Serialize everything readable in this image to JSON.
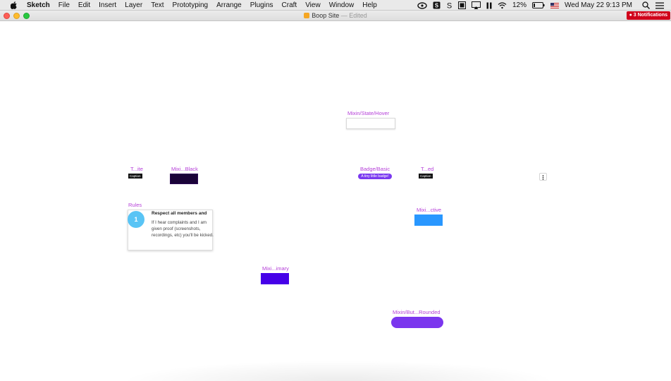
{
  "menubar": {
    "app_name": "Sketch",
    "items": [
      "File",
      "Edit",
      "Insert",
      "Layer",
      "Text",
      "Prototyping",
      "Arrange",
      "Plugins",
      "Craft",
      "View",
      "Window",
      "Help"
    ],
    "battery": "12%",
    "datetime": "Wed May 22  9:13 PM",
    "icons": [
      "creative-cloud-icon",
      "s-box-icon",
      "s-icon",
      "grid-icon",
      "airplay-icon",
      "pause-icon",
      "wifi-icon",
      "battery-icon",
      "flag-us-icon",
      "search-icon",
      "list-icon"
    ]
  },
  "window": {
    "title": "Boop Site",
    "edited_suffix": "— Edited",
    "notifications": "3 Notifications"
  },
  "canvas": {
    "hover_label": "Mixin/State/Hover",
    "white_label": "T...ite",
    "white_caption": "Caption",
    "black_label": "Mixi...Black",
    "badge_label": "Badge/Basic",
    "badge_text": "A tiny little badge!",
    "ted_label": "T...ed",
    "ted_caption": "Caption",
    "rules_label": "Rules",
    "rule_number": "1",
    "rule_title": "Respect all members and",
    "rule_body": "If I hear complaints and I am given proof (screenshots, recordings, etc) you'll be kicked.",
    "active_label": "Mixi...ctive",
    "primary_label": "Mixi...imary",
    "rounded_label": "Mixin/But...Rounded"
  },
  "colors": {
    "label": "#b53fd8",
    "dark": "#1a0338",
    "badge": "#7b39f0",
    "active": "#2997ff",
    "primary": "#4600e8",
    "rounded": "#7b36ee",
    "rule_circle": "#59c4f5"
  }
}
